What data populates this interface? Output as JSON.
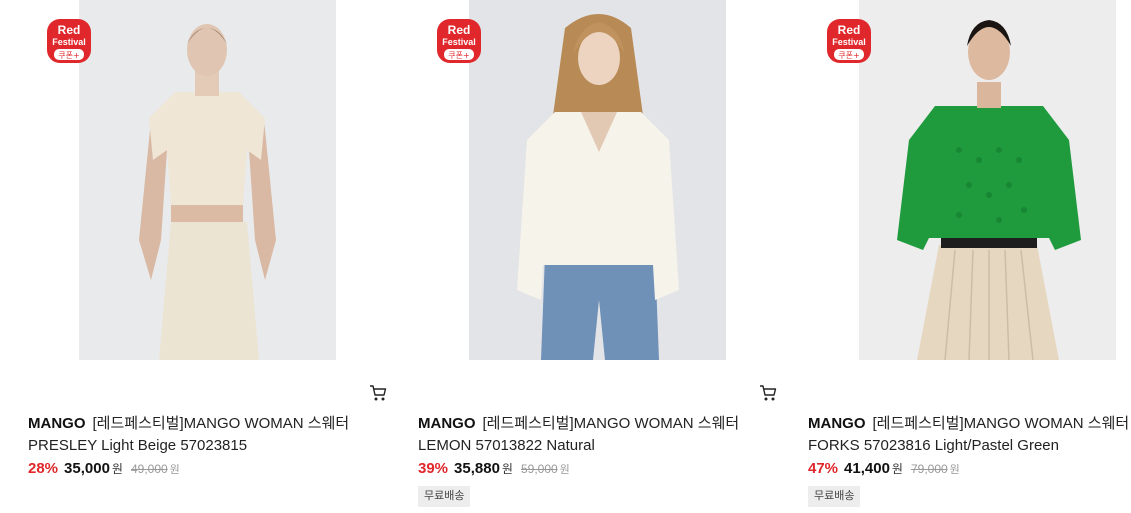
{
  "badge": {
    "line1": "Red",
    "line2": "Festival",
    "line3": "쿠폰+",
    "color": "#e0272b"
  },
  "products": [
    {
      "brand": "MANGO",
      "name_line1": "[레드페스티벌]MANGO WOMAN 스웨터",
      "name_line2": "PRESLEY Light Beige 57023815",
      "discount": "28%",
      "price": "35,000",
      "currency": "원",
      "original_price": "49,000",
      "original_currency": "원",
      "shipping_tag": "",
      "image": "model-beige-knit-top-skirt"
    },
    {
      "brand": "MANGO",
      "name_line1": "[레드페스티벌]MANGO WOMAN 스웨터",
      "name_line2": "LEMON 57013822 Natural",
      "discount": "39%",
      "price": "35,880",
      "currency": "원",
      "original_price": "59,000",
      "original_currency": "원",
      "shipping_tag": "무료배송",
      "image": "model-cream-sweater-jeans"
    },
    {
      "brand": "MANGO",
      "name_line1": "[레드페스티벌]MANGO WOMAN 스웨터",
      "name_line2": "FORKS 57023816 Light/Pastel Green",
      "discount": "47%",
      "price": "41,400",
      "currency": "원",
      "original_price": "79,000",
      "original_currency": "원",
      "shipping_tag": "무료배송",
      "image": "model-green-sweater-pleated-skirt"
    }
  ],
  "icons": {
    "cart": "cart-icon"
  }
}
